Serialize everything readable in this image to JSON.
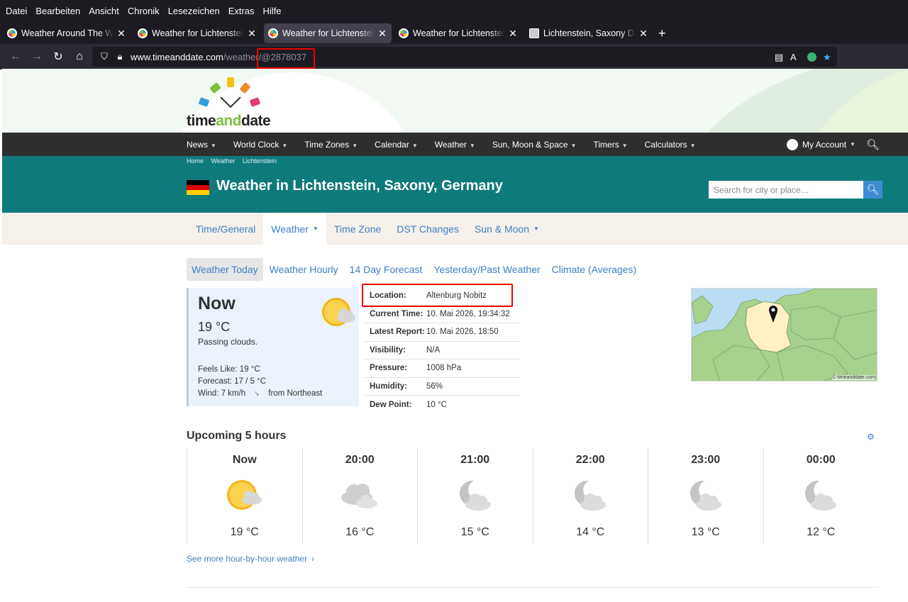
{
  "browser": {
    "menu": [
      "Datei",
      "Bearbeiten",
      "Ansicht",
      "Chronik",
      "Lesezeichen",
      "Extras",
      "Hilfe"
    ],
    "tabs": [
      {
        "label": "Weather Around The Wor",
        "icon": "tad-favicon"
      },
      {
        "label": "Weather for Lichtenstein/",
        "icon": "tad-favicon"
      },
      {
        "label": "Weather for Lichtenstein,",
        "icon": "tad-favicon"
      },
      {
        "label": "Weather for Lichtenstein,",
        "icon": "tad-favicon"
      },
      {
        "label": "Lichtenstein, Saxony Daily",
        "icon": "doc-favicon"
      }
    ],
    "url": {
      "host": "www.timeanddate.com",
      "path": "/weather/",
      "highlight": "@2878037"
    }
  },
  "site": {
    "logo_text_a": "time",
    "logo_text_b": "and",
    "logo_text_c": "date",
    "nav": [
      "News",
      "World Clock",
      "Time Zones",
      "Calendar",
      "Weather",
      "Sun, Moon & Space",
      "Timers",
      "Calculators"
    ],
    "account": "My Account",
    "breadcrumbs": [
      "Home",
      "Weather",
      "Lichtenstein"
    ],
    "title": "Weather in Lichtenstein, Saxony, Germany",
    "search_placeholder": "Search for city or place…",
    "subnav": [
      "Time/General",
      "Weather",
      "Time Zone",
      "DST Changes",
      "Sun & Moon"
    ],
    "weather_tabs": [
      "Weather Today",
      "Weather Hourly",
      "14 Day Forecast",
      "Yesterday/Past Weather",
      "Climate (Averages)"
    ]
  },
  "now": {
    "heading": "Now",
    "temp": "19 °C",
    "condition": "Passing clouds.",
    "feels_like": "Feels Like: 19 °C",
    "forecast": "Forecast: 17 / 5 °C",
    "wind": "Wind: 7 km/h",
    "wind_dir": "from Northeast"
  },
  "details": [
    {
      "k": "Location:",
      "v": "Altenburg Nobitz"
    },
    {
      "k": "Current Time:",
      "v": "10. Mai 2026, 19:34:32"
    },
    {
      "k": "Latest Report:",
      "v": "10. Mai 2026, 18:50"
    },
    {
      "k": "Visibility:",
      "v": "N/A"
    },
    {
      "k": "Pressure:",
      "v": "1008 hPa"
    },
    {
      "k": "Humidity:",
      "v": "56%"
    },
    {
      "k": "Dew Point:",
      "v": "10 °C"
    }
  ],
  "map_credit": "© timeanddate.com",
  "upcoming": {
    "title": "Upcoming 5 hours",
    "hours": [
      {
        "time": "Now",
        "temp": "19 °C",
        "icon": "sun-cloud-icon"
      },
      {
        "time": "20:00",
        "temp": "16 °C",
        "icon": "clouds-icon"
      },
      {
        "time": "21:00",
        "temp": "15 °C",
        "icon": "moon-cloud-icon"
      },
      {
        "time": "22:00",
        "temp": "14 °C",
        "icon": "moon-cloud-icon"
      },
      {
        "time": "23:00",
        "temp": "13 °C",
        "icon": "moon-cloud-icon"
      },
      {
        "time": "00:00",
        "temp": "12 °C",
        "icon": "moon-cloud-icon"
      }
    ],
    "more_link": "See more hour-by-hour weather"
  },
  "colors": {
    "teal": "#0f7a7c",
    "link": "#3f7ec4",
    "highlight": "#ee0000"
  }
}
